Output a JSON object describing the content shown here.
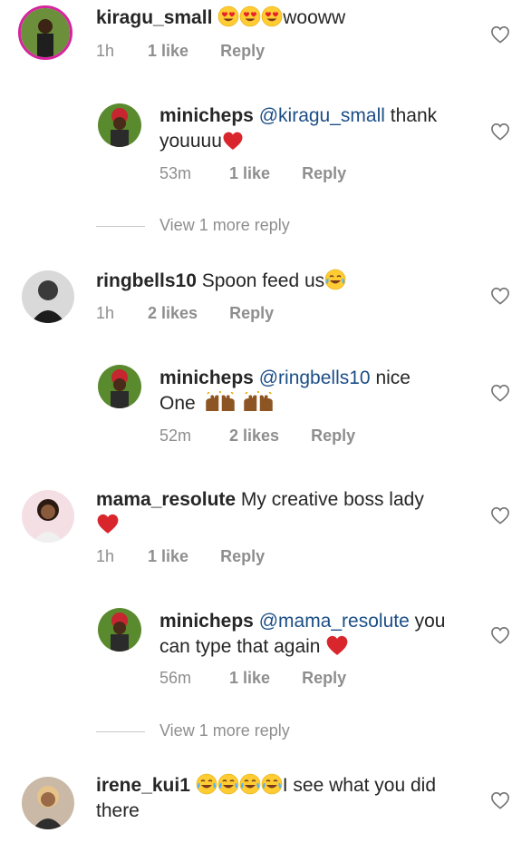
{
  "comments": [
    {
      "user": "kiragu_small",
      "text_after": "wooww",
      "time": "1h",
      "likes": "1 like",
      "reply": "Reply"
    },
    {
      "user": "minicheps",
      "mention": "@kiragu_small",
      "text_after": " thank youuuu",
      "time": "53m",
      "likes": "1 like",
      "reply": "Reply"
    },
    {
      "user": "ringbells10",
      "text_after": " Spoon feed us",
      "time": "1h",
      "likes": "2 likes",
      "reply": "Reply"
    },
    {
      "user": "minicheps",
      "mention": "@ringbells10",
      "text_after": " nice One",
      "time": "52m",
      "likes": "2 likes",
      "reply": "Reply"
    },
    {
      "user": "mama_resolute",
      "text_after": " My creative boss lady",
      "time": "1h",
      "likes": "1 like",
      "reply": "Reply"
    },
    {
      "user": "minicheps",
      "mention": "@mama_resolute",
      "text_after": " you can type that again",
      "time": "56m",
      "likes": "1 like",
      "reply": "Reply"
    },
    {
      "user": "irene_kui1",
      "text_after": "I see what you did there"
    }
  ],
  "view_more_1": "View 1 more reply",
  "view_more_2": "View 1 more reply",
  "colors": {
    "username": "#262626",
    "mention": "#1b4e86",
    "meta": "#8e8e8e",
    "heart_red": "#d9262c"
  },
  "icons": [
    "heart-outline-icon",
    "heart-emoji",
    "heart-eyes-emoji",
    "tears-of-joy-emoji",
    "raising-hands-emoji"
  ]
}
